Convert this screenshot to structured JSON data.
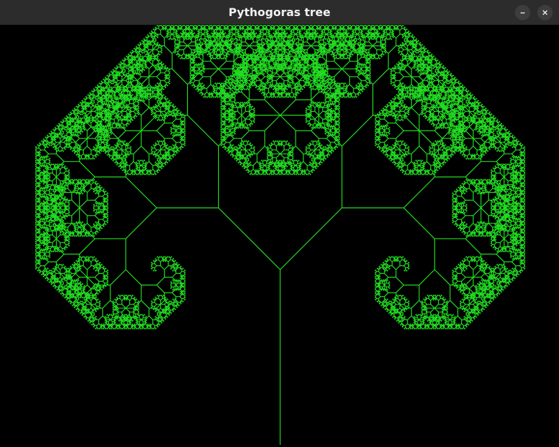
{
  "window": {
    "title": "Pythogoras tree",
    "buttons": {
      "minimize_icon": "minimize-icon",
      "close_icon": "close-icon"
    }
  },
  "canvas": {
    "background": "#000000",
    "line_color": "#22dd22"
  }
}
